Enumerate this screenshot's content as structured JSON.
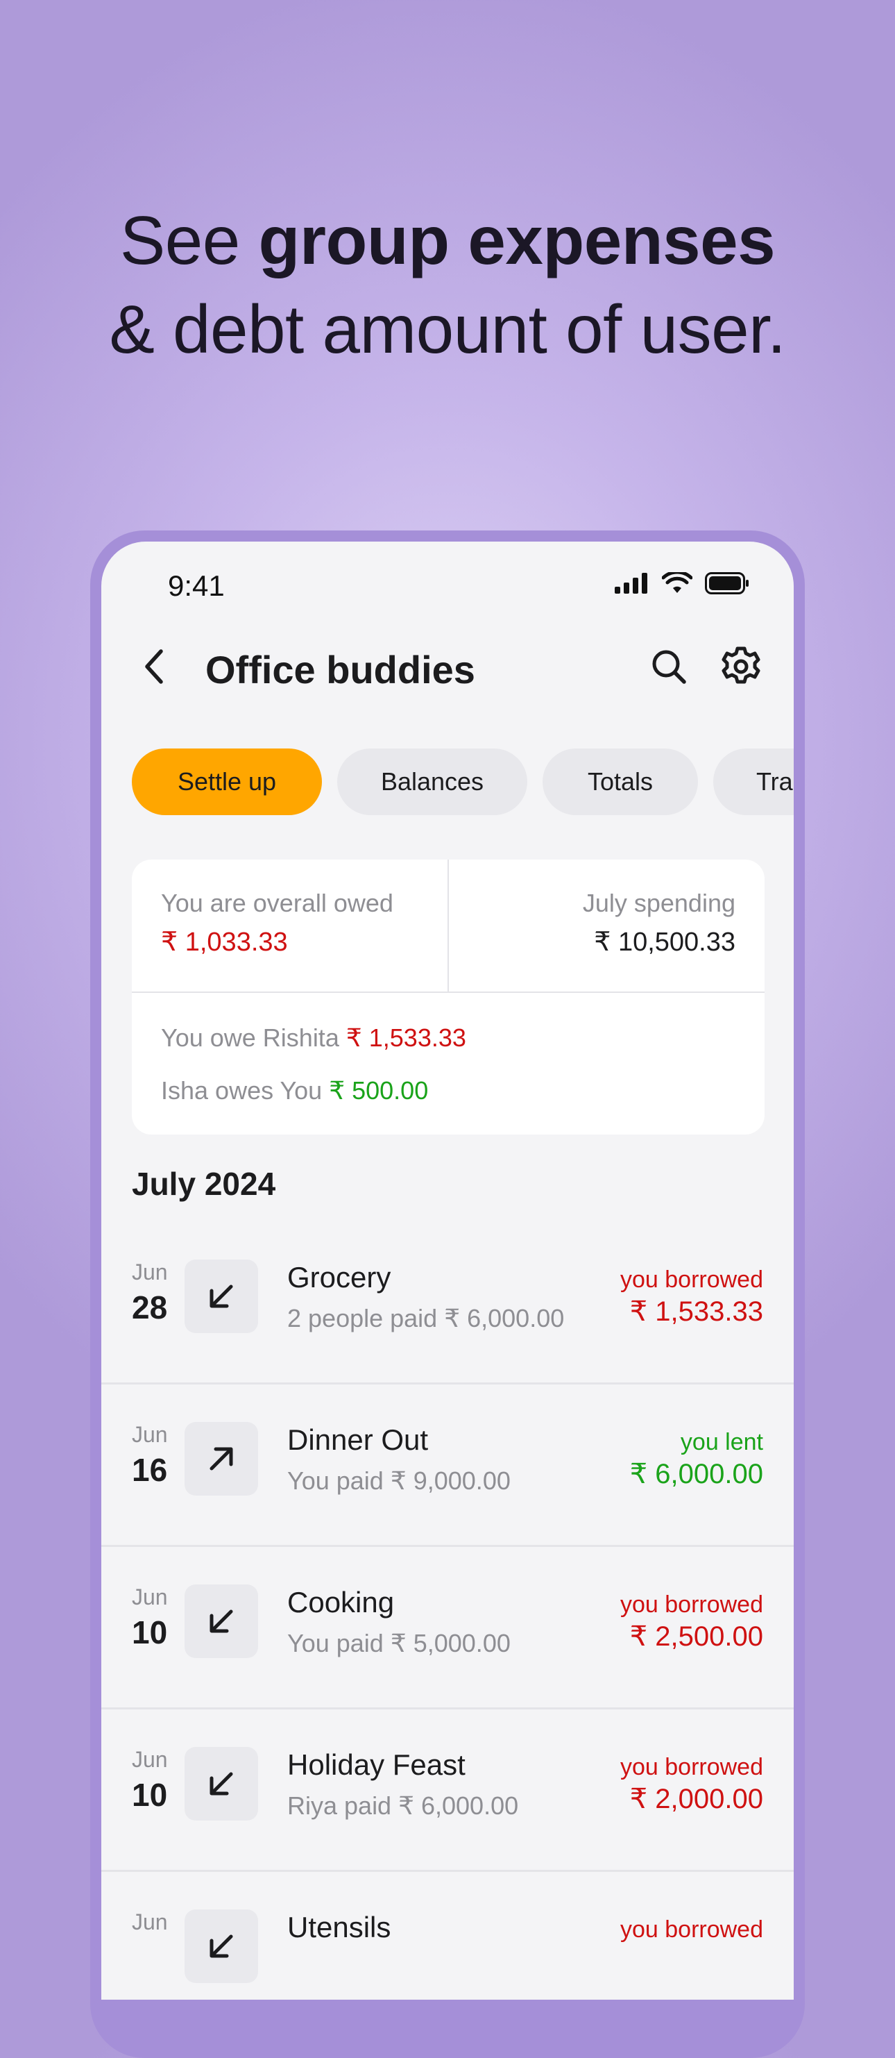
{
  "headline": {
    "pre": "See ",
    "bold": "group expenses",
    "line2": "& debt amount of user."
  },
  "status_bar": {
    "time": "9:41"
  },
  "header": {
    "title": "Office buddies"
  },
  "chips": [
    {
      "label": "Settle up"
    },
    {
      "label": "Balances"
    },
    {
      "label": "Totals"
    },
    {
      "label": "Transactions"
    }
  ],
  "summary": {
    "overall_label": "You are overall owed",
    "overall_value": "₹ 1,033.33",
    "spending_label": "July spending",
    "spending_value": "₹ 10,500.33",
    "line1_text": "You owe Rishita ",
    "line1_amount": "₹ 1,533.33",
    "line2_text": "Isha owes You ",
    "line2_amount": "₹ 500.00"
  },
  "section_title": "July 2024",
  "transactions": [
    {
      "month": "Jun",
      "day": "28",
      "name": "Grocery",
      "detail": "2 people paid ₹ 6,000.00",
      "status": "you borrowed",
      "amount": "₹ 1,533.33",
      "direction": "in"
    },
    {
      "month": "Jun",
      "day": "16",
      "name": "Dinner Out",
      "detail": "You paid ₹ 9,000.00",
      "status": "you lent",
      "amount": "₹ 6,000.00",
      "direction": "out"
    },
    {
      "month": "Jun",
      "day": "10",
      "name": "Cooking",
      "detail": "You paid ₹ 5,000.00",
      "status": "you borrowed",
      "amount": "₹ 2,500.00",
      "direction": "in"
    },
    {
      "month": "Jun",
      "day": "10",
      "name": "Holiday Feast",
      "detail": "Riya paid ₹ 6,000.00",
      "status": "you borrowed",
      "amount": "₹ 2,000.00",
      "direction": "in"
    },
    {
      "month": "Jun",
      "day": "",
      "name": "Utensils",
      "detail": "",
      "status": "you borrowed",
      "amount": "",
      "direction": "in"
    }
  ],
  "colors": {
    "accent": "#ffa600",
    "owed": "#cf1111",
    "lent": "#1aa31a",
    "background": "#c6b5ea"
  },
  "icons": [
    "back-icon",
    "search-icon",
    "gear-icon",
    "arrow-down-left-icon",
    "arrow-up-right-icon",
    "signal-icon",
    "wifi-icon",
    "battery-icon"
  ]
}
